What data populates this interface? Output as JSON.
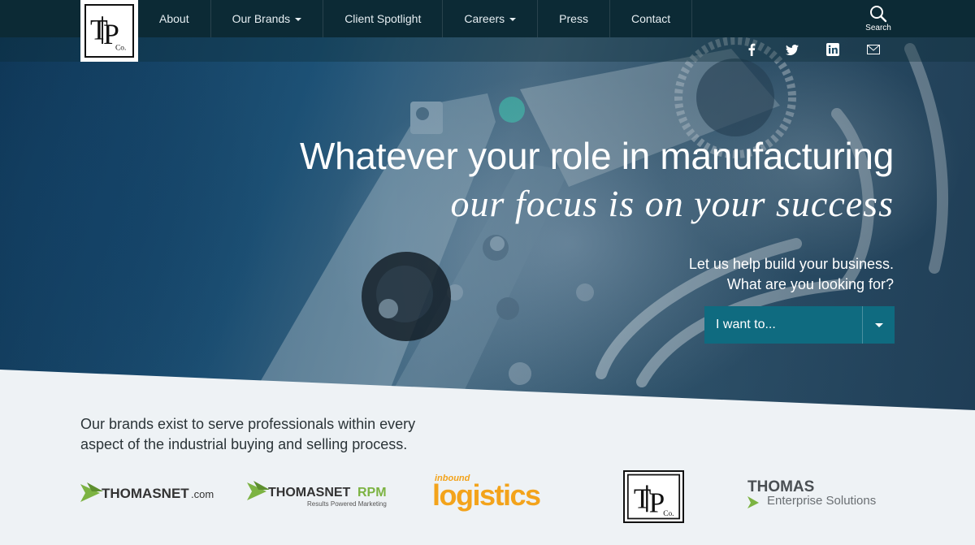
{
  "nav": {
    "items": [
      {
        "label": "About"
      },
      {
        "label": "Our Brands"
      },
      {
        "label": "Client Spotlight"
      },
      {
        "label": "Careers"
      },
      {
        "label": "Press"
      },
      {
        "label": "Contact"
      }
    ],
    "search_label": "Search",
    "logo": "TIP Co. LLC"
  },
  "social": [
    "facebook-icon",
    "twitter-icon",
    "linkedin-icon",
    "email-icon"
  ],
  "hero": {
    "headline": "Whatever your role in manufacturing",
    "headline_italic": "our focus is on your success",
    "sub1": "Let us help build your business.",
    "sub2": "What are you looking for?",
    "select_value": "I want to..."
  },
  "brands": {
    "tagline": "Our brands exist to serve professionals within every aspect of the industrial buying and selling process.",
    "logos": [
      {
        "name": "THOMASNET",
        "suffix": ".com"
      },
      {
        "name": "THOMASNET",
        "accent": "RPM",
        "sub": "Results Powered Marketing"
      },
      {
        "small": "inbound",
        "name": "logistics"
      },
      {
        "name": "TIP Co."
      },
      {
        "name": "THOMAS",
        "sub": "Enterprise Solutions"
      }
    ]
  },
  "colors": {
    "nav_bg": "#0c2a35",
    "accent_teal": "#0f6b80",
    "thomas_green": "#7cb342",
    "logistics_orange": "#f3a31b"
  }
}
